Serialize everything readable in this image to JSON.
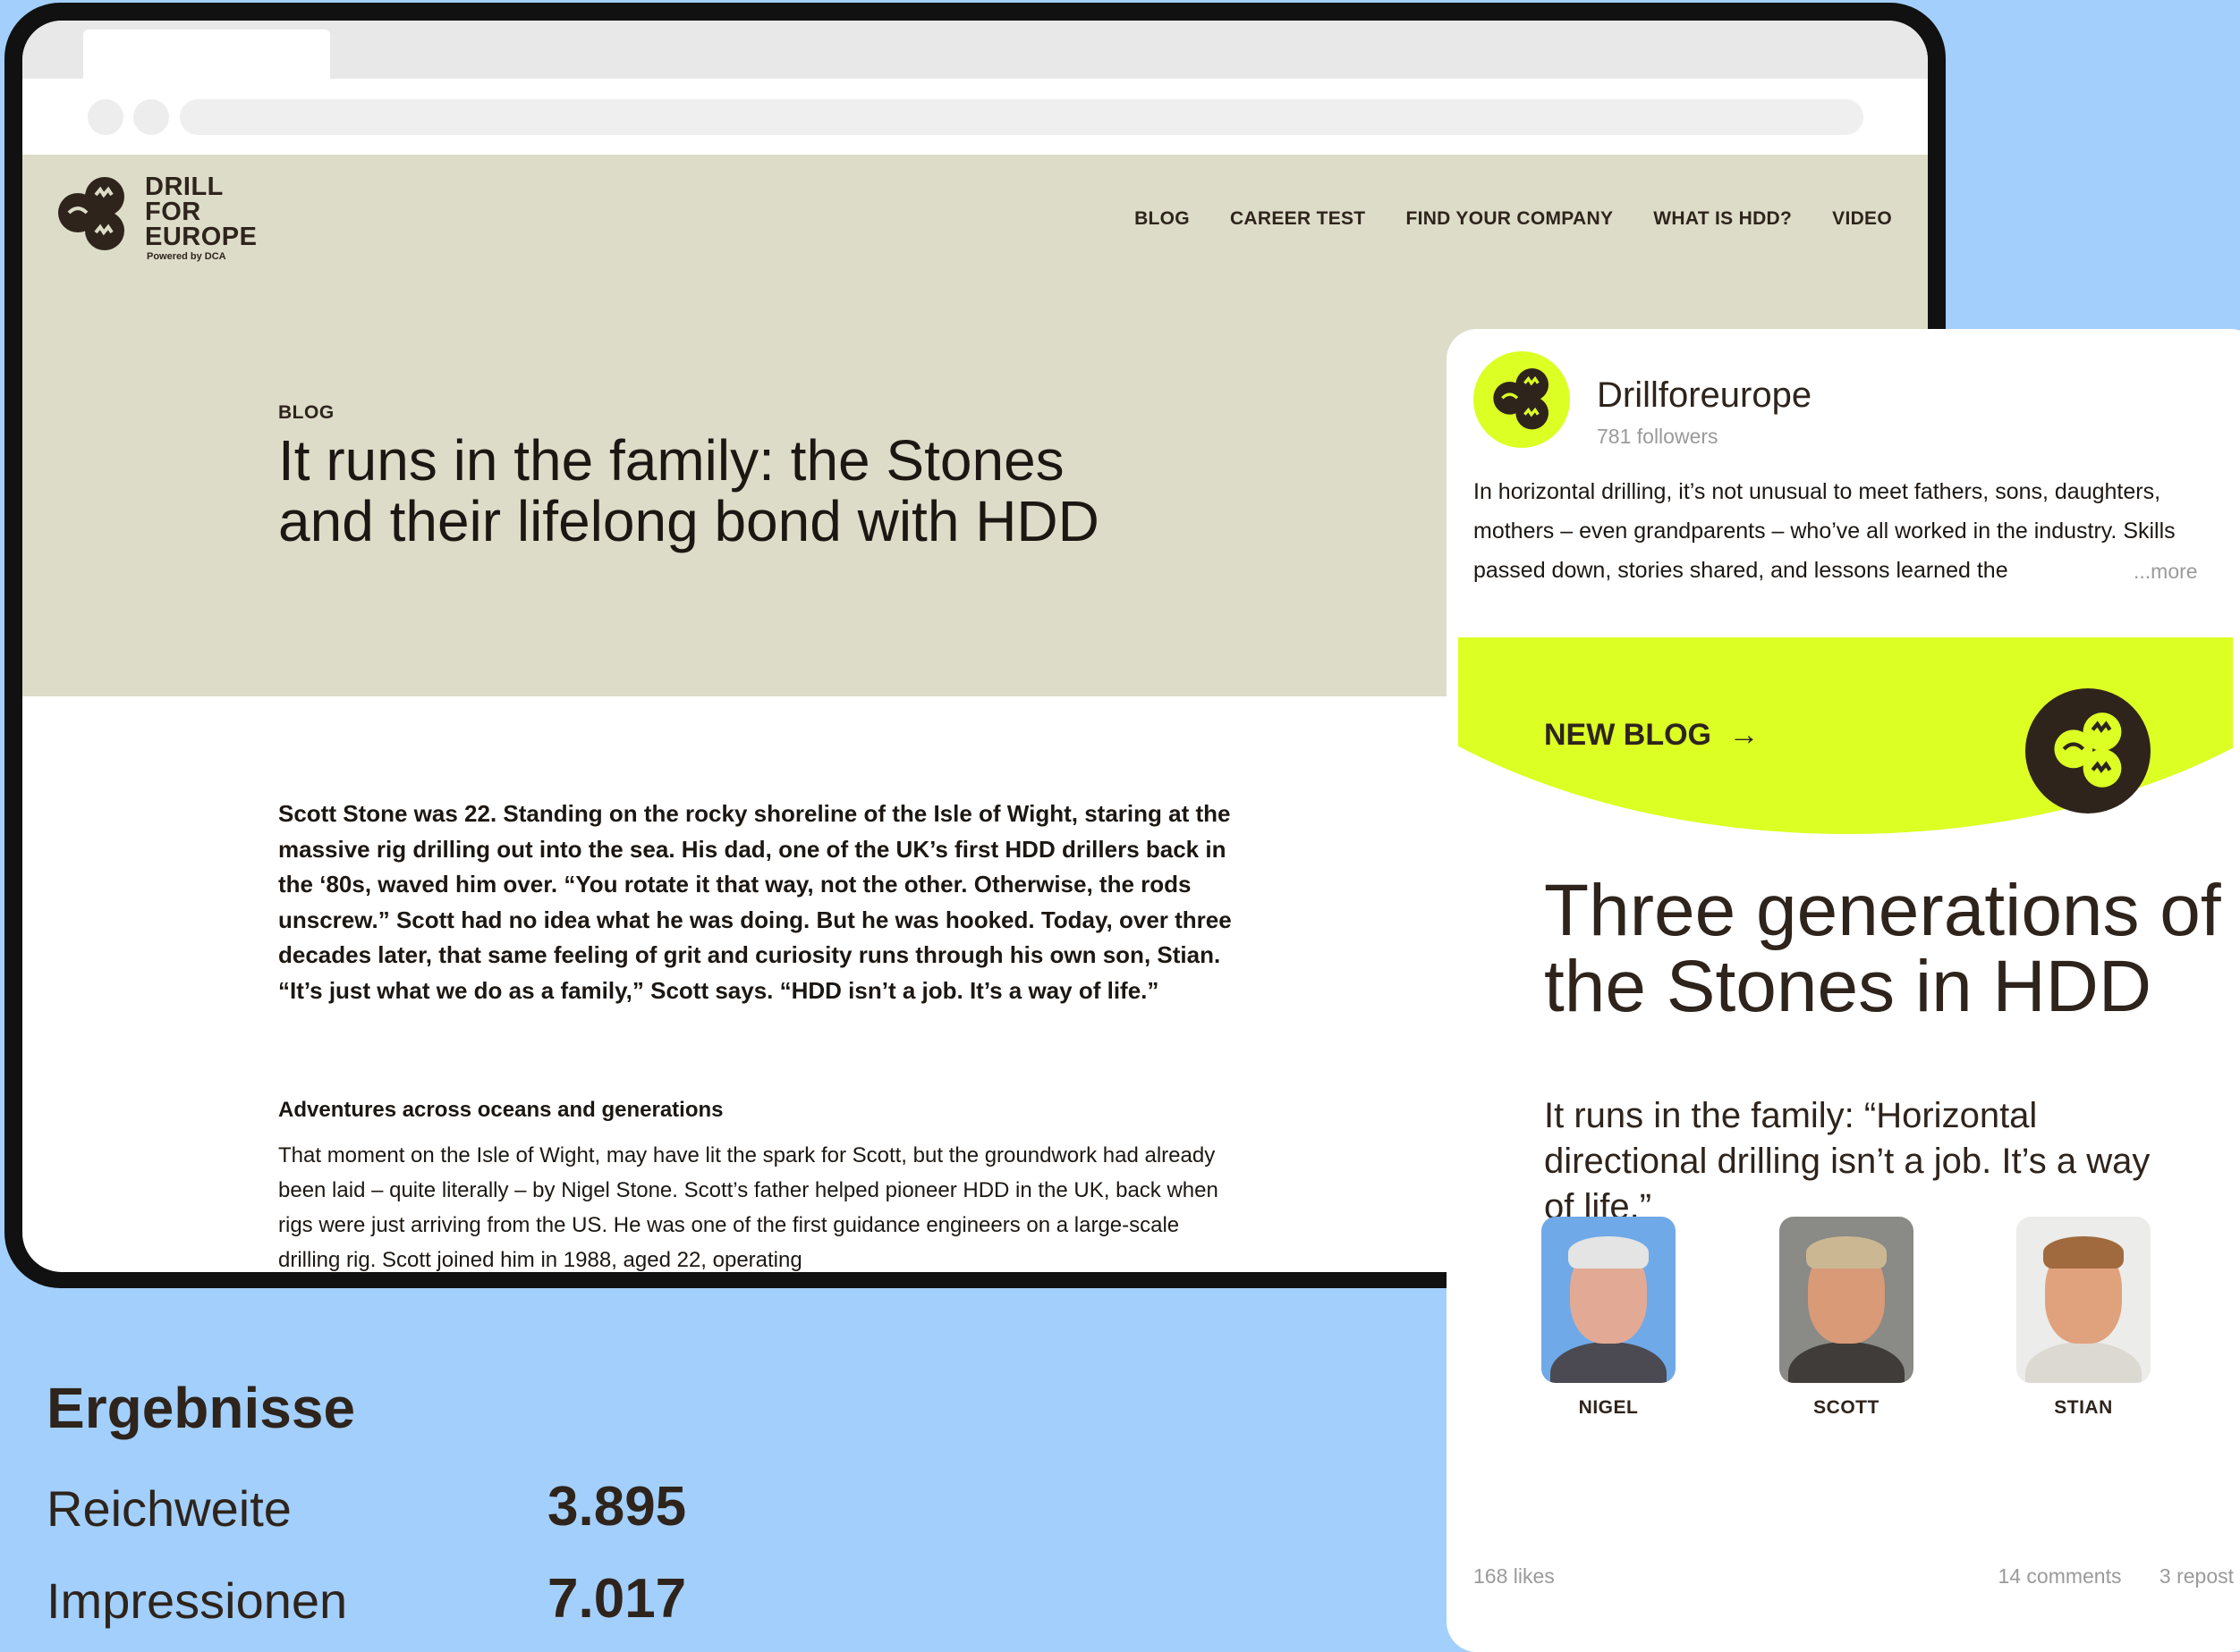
{
  "browser": {
    "nav": [
      "BLOG",
      "CAREER TEST",
      "FIND YOUR COMPANY",
      "WHAT IS HDD?",
      "VIDEO"
    ],
    "logo": {
      "line1": "DRILL",
      "line2": "FOR",
      "line3": "EUROPE",
      "sub": "Powered by DCA"
    },
    "article": {
      "kicker": "BLOG",
      "title": "It runs in the family: the Stones and their lifelong bond with HDD",
      "lead": "Scott Stone was 22. Standing on the rocky shoreline of the Isle of Wight, staring at the massive rig drilling out into the sea. His dad, one of the UK’s first HDD drillers back in the ‘80s, waved him over. “You rotate it that way, not the other. Otherwise, the rods unscrew.” Scott had no idea what he was doing. But he was hooked. Today, over three decades later, that same feeling of grit and curiosity runs through his own son, Stian. “It’s just what we do as a family,” Scott says. “HDD isn’t a job. It’s a way of life.”",
      "subhead": "Adventures across oceans and generations",
      "body": "That moment on the Isle of Wight, may have lit the spark for Scott, but the groundwork had already been laid – quite literally – by Nigel Stone. Scott’s father helped pioneer HDD in the UK, back when rigs were just arriving from the US. He was one of the first guidance engineers on a large-scale drilling rig. Scott joined him in 1988, aged 22, operating"
    }
  },
  "results": {
    "title": "Ergebnisse",
    "rows": [
      {
        "label": "Reichweite",
        "value": "3.895"
      },
      {
        "label": "Impressionen",
        "value": "7.017"
      }
    ]
  },
  "social": {
    "account": "Drillforeurope",
    "followers": "781 followers",
    "post": "In horizontal drilling, it’s not unusual to meet fathers, sons, daughters, mothers – even grandparents – who’ve all worked in the industry. Skills passed down, stories shared, and lessons learned the",
    "more": "...more",
    "banner_label": "NEW BLOG",
    "arrow": "→",
    "promo_title": "Three generations of the Stones in HDD",
    "promo_sub": "It runs in the family: “Horizontal directional drilling isn’t a job. It’s a way of life.”",
    "people": [
      "NIGEL",
      "SCOTT",
      "STIAN"
    ],
    "likes": "168 likes",
    "comments": "14 comments",
    "reposts": "3 repost",
    "colors": {
      "accent": "#dcff24",
      "brand_dark": "#2e241c",
      "background": "#a3cffc",
      "hero": "#dcdcc8"
    }
  }
}
